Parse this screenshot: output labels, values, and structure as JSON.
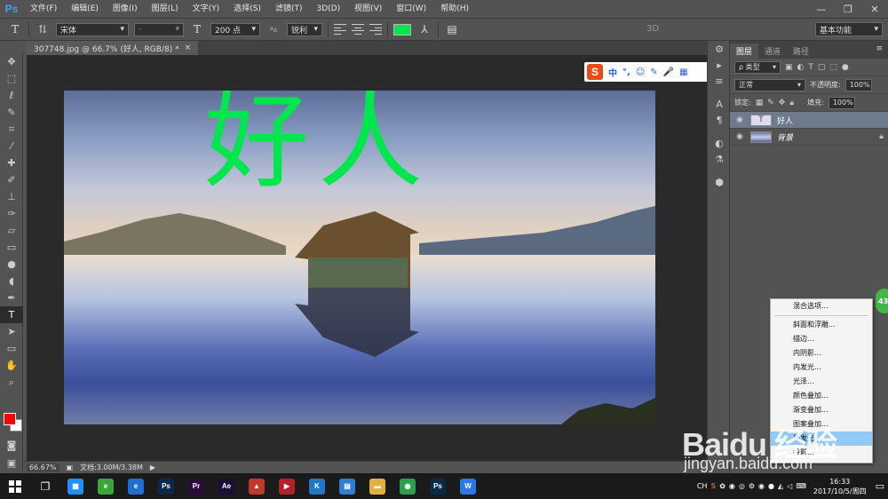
{
  "app": {
    "logo": "Ps"
  },
  "menu": [
    "文件(F)",
    "编辑(E)",
    "图像(I)",
    "图层(L)",
    "文字(Y)",
    "选择(S)",
    "滤镜(T)",
    "3D(D)",
    "视图(V)",
    "窗口(W)",
    "帮助(H)"
  ],
  "window_controls": {
    "minimize": "—",
    "restore": "❐",
    "close": "✕"
  },
  "options": {
    "font_family": "宋体",
    "font_style": "-",
    "font_size": "200 点",
    "antialias_label": "ªa",
    "antialias": "锐利",
    "text_color": "#00e64d",
    "mode_3d": "3D",
    "workspace": "基本功能"
  },
  "document_tab": {
    "title": "307748.jpg @ 66.7% (好人, RGB/8) *",
    "close": "×"
  },
  "canvas": {
    "text": "好人",
    "text_color": "#00e64d"
  },
  "sogou": {
    "logo": "S",
    "items": [
      "中",
      "°,",
      "☺",
      "✎",
      "🎤",
      "▦"
    ]
  },
  "statusbar": {
    "zoom": "66.67%",
    "doc": "文档:3.00M/3.38M"
  },
  "layers_panel": {
    "tabs": [
      "图层",
      "通道",
      "路径"
    ],
    "filter": "ρ 类型",
    "blend_mode": "正常",
    "opacity_label": "不透明度:",
    "opacity": "100%",
    "lock_label": "锁定:",
    "fill_label": "填充:",
    "fill": "100%",
    "layers": [
      {
        "name": "好人",
        "type": "text",
        "selected": true
      },
      {
        "name": "背景",
        "type": "image",
        "selected": false
      }
    ]
  },
  "context_menu": {
    "items": [
      "混合选项...",
      "斜面和浮雕...",
      "描边...",
      "内阴影...",
      "内发光...",
      "光泽...",
      "颜色叠加...",
      "渐变叠加...",
      "图案叠加...",
      "外发光...",
      "投影..."
    ],
    "highlighted_index": 9
  },
  "green_badge": "43",
  "taskbar": {
    "apps": [
      {
        "name": "file-explorer-old",
        "label": "▦",
        "color": "#1e90ff"
      },
      {
        "name": "360-browser",
        "label": "e",
        "color": "#3aa63a"
      },
      {
        "name": "ie",
        "label": "e",
        "color": "#1f6fd1"
      },
      {
        "name": "photoshop",
        "label": "Ps",
        "color": "#0b2a4a"
      },
      {
        "name": "premiere",
        "label": "Pr",
        "color": "#2b0a3d"
      },
      {
        "name": "after-effects",
        "label": "Ae",
        "color": "#1b0f3a"
      },
      {
        "name": "acrobat",
        "label": "▲",
        "color": "#c0392b"
      },
      {
        "name": "media-player",
        "label": "▶",
        "color": "#b3202a"
      },
      {
        "name": "k-app",
        "label": "K",
        "color": "#1f78c8"
      },
      {
        "name": "calculator",
        "label": "▤",
        "color": "#2d7dd2"
      },
      {
        "name": "folder",
        "label": "▬",
        "color": "#e0b040"
      },
      {
        "name": "chrome",
        "label": "◉",
        "color": "#2e9e4f"
      },
      {
        "name": "photoshop-active",
        "label": "Ps",
        "color": "#0b2a4a"
      },
      {
        "name": "wps",
        "label": "W",
        "color": "#2b78e4"
      }
    ],
    "tray_lang": "CH",
    "time": "16:33",
    "date": "2017/10/5/周四"
  },
  "watermark": {
    "line1": "Baidu 经验",
    "line2": "jingyan.baidu.com"
  }
}
